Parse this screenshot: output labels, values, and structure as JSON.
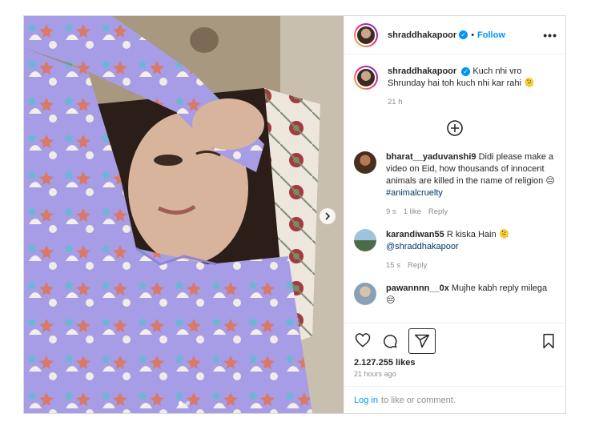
{
  "header": {
    "username": "shraddhakapoor",
    "separator": "•",
    "follow_label": "Follow",
    "more_label": "•••"
  },
  "caption": {
    "username": "shraddhakapoor",
    "text": "Kuch nhi vro Shrunday hai toh kuch nhi kar rahi 🫠",
    "time": "21 h"
  },
  "comments": [
    {
      "username": "bharat__yaduvanshi9",
      "text": "Didi please make a video on Eid, how thousands of innocent animals are killed in the name of religion 😔",
      "hashtag": "#animalcruelty",
      "time": "9 s",
      "likes": "1 like",
      "reply": "Reply"
    },
    {
      "username": "karandiwan55",
      "text": "R kiska Hain 🫠",
      "mention": "@shraddhakapoor",
      "time": "15 s",
      "reply": "Reply"
    },
    {
      "username": "pawannnn__0x",
      "text": "Mujhe kabh reply milega 😔"
    }
  ],
  "actions": {
    "like_icon": "heart-icon",
    "comment_icon": "comment-icon",
    "share_icon": "send-icon",
    "save_icon": "bookmark-icon"
  },
  "likes_text": "2.127.255 likes",
  "posted_ago": "21 hours ago",
  "login_prompt": {
    "link": "Log in",
    "text": "to like or comment."
  },
  "media": {
    "carousel_dots": 2,
    "active_dot": 0
  },
  "colors": {
    "accent": "#0095f6",
    "pajama": "#a9a0e8",
    "text": "#262626",
    "muted": "#8e8e8e"
  }
}
